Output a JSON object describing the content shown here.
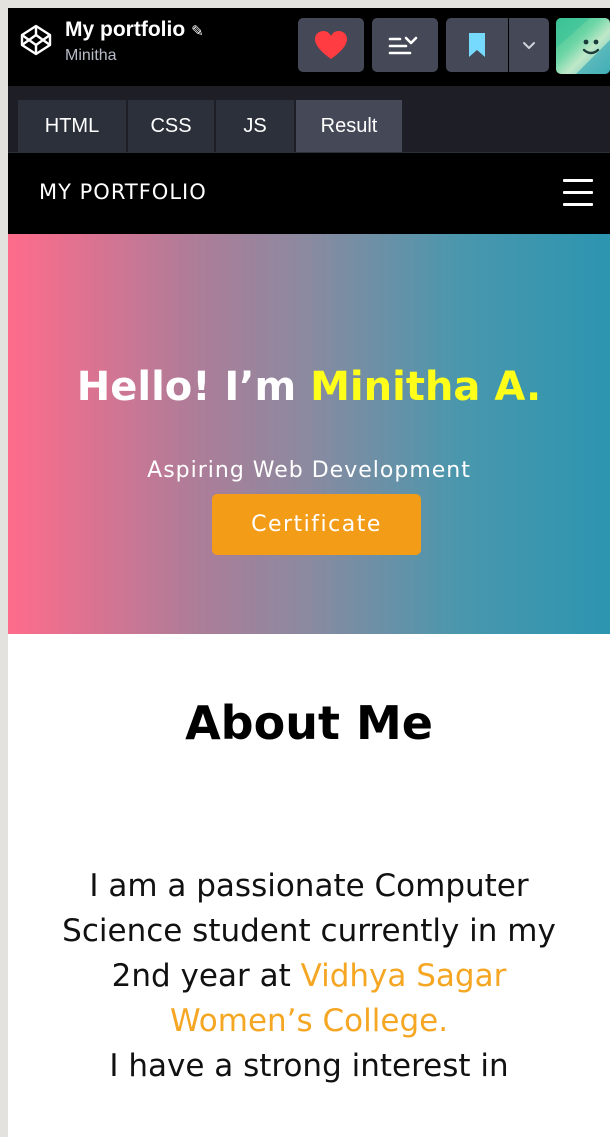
{
  "codepen": {
    "pen_title": "My portfolio",
    "pen_author": "Minitha",
    "tabs": [
      {
        "label": "HTML"
      },
      {
        "label": "CSS"
      },
      {
        "label": "JS"
      },
      {
        "label": "Result"
      }
    ],
    "active_tab": "Result"
  },
  "site": {
    "brand": "MY PORTFOLIO",
    "hero": {
      "greeting": "Hello! I’m ",
      "name": "Minitha A.",
      "subtitle": "Aspiring Web Development",
      "button_label": "Certificate"
    },
    "about": {
      "title": "About Me",
      "text_part1": "I am a passionate Computer Science student currently in my 2nd year at ",
      "college": "Vidhya Sagar Women’s College.",
      "text_part2": "I have a strong interest in"
    }
  },
  "icons": {
    "logo": "codepen-logo-icon",
    "edit": "pencil-icon",
    "heart": "heart-icon",
    "view": "change-view-icon",
    "save": "bookmark-icon",
    "caret": "chevron-down-icon",
    "menu": "hamburger-menu-icon"
  },
  "colors": {
    "heart": "#ff3c41",
    "bookmark": "#76daff",
    "name_highlight": "#ffff19",
    "college_highlight": "#f5a623",
    "certificate_button": "#f39c18",
    "hero_gradient_start": "#ff6b8b",
    "hero_gradient_end": "#2c95b0"
  }
}
